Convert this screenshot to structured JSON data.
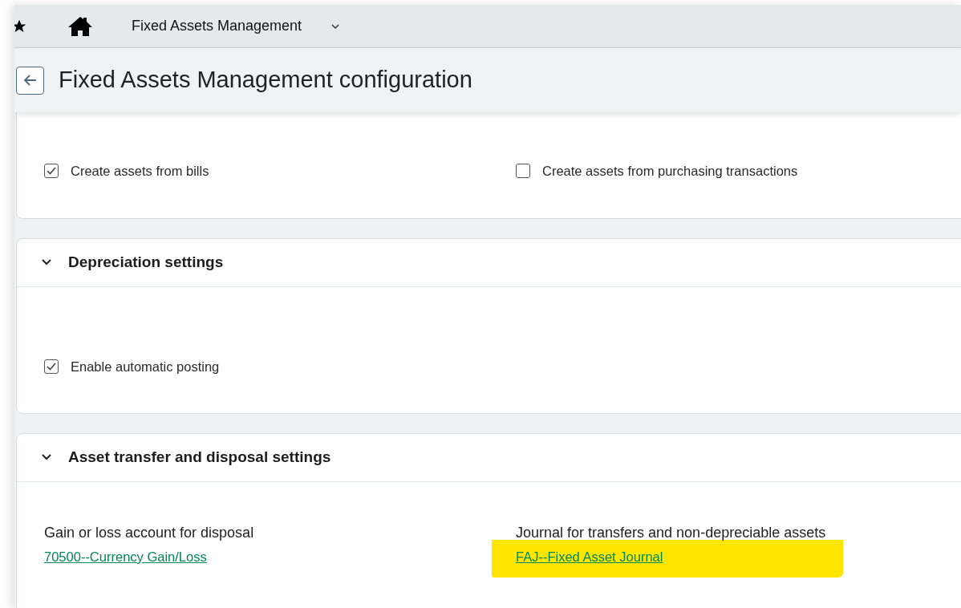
{
  "topbar": {
    "module": "Fixed Assets Management"
  },
  "header": {
    "title": "Fixed Assets Management configuration"
  },
  "sections": [
    {
      "items": [
        {
          "kind": "checkbox",
          "label": "Create assets from bills",
          "checked": true
        },
        {
          "kind": "checkbox",
          "label": "Create assets from purchasing transactions",
          "checked": false
        }
      ]
    },
    {
      "title": "Depreciation settings",
      "expanded": true,
      "items": [
        {
          "kind": "checkbox",
          "label": "Enable automatic posting",
          "checked": true
        }
      ]
    },
    {
      "title": "Asset transfer and disposal settings",
      "expanded": true,
      "items": [
        {
          "kind": "link",
          "label": "Gain or loss account for disposal",
          "value": "70500--Currency Gain/Loss",
          "highlighted": false
        },
        {
          "kind": "link",
          "label": "Journal for transfers and non-depreciable assets",
          "value": "FAJ--Fixed Asset Journal",
          "highlighted": true
        }
      ]
    }
  ]
}
